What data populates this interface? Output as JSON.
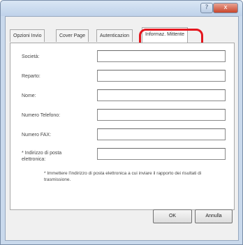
{
  "window": {
    "help_glyph": "?",
    "close_glyph": "x"
  },
  "tabs": [
    {
      "label": "Opzioni Invio"
    },
    {
      "label": "Cover Page"
    },
    {
      "label": "Autenticazion"
    },
    {
      "label": "Informaz. Mittente"
    }
  ],
  "form": {
    "fields": [
      {
        "label": "Società:",
        "value": ""
      },
      {
        "label": "Reparto:",
        "value": ""
      },
      {
        "label": "Nome:",
        "value": ""
      },
      {
        "label": "Numero Telefono:",
        "value": ""
      },
      {
        "label": "Numero FAX:",
        "value": ""
      },
      {
        "label": "* Indirizzo di posta elettronica:",
        "value": ""
      }
    ],
    "note": "* Immettere l'indirizzo di posta elettronica a cui inviare il rapporto dei risultati di trasmissione."
  },
  "buttons": {
    "ok_label": "OK",
    "cancel_label": "Annulla"
  },
  "colors": {
    "highlight": "#e4161e",
    "close_button": "#c9452b"
  }
}
